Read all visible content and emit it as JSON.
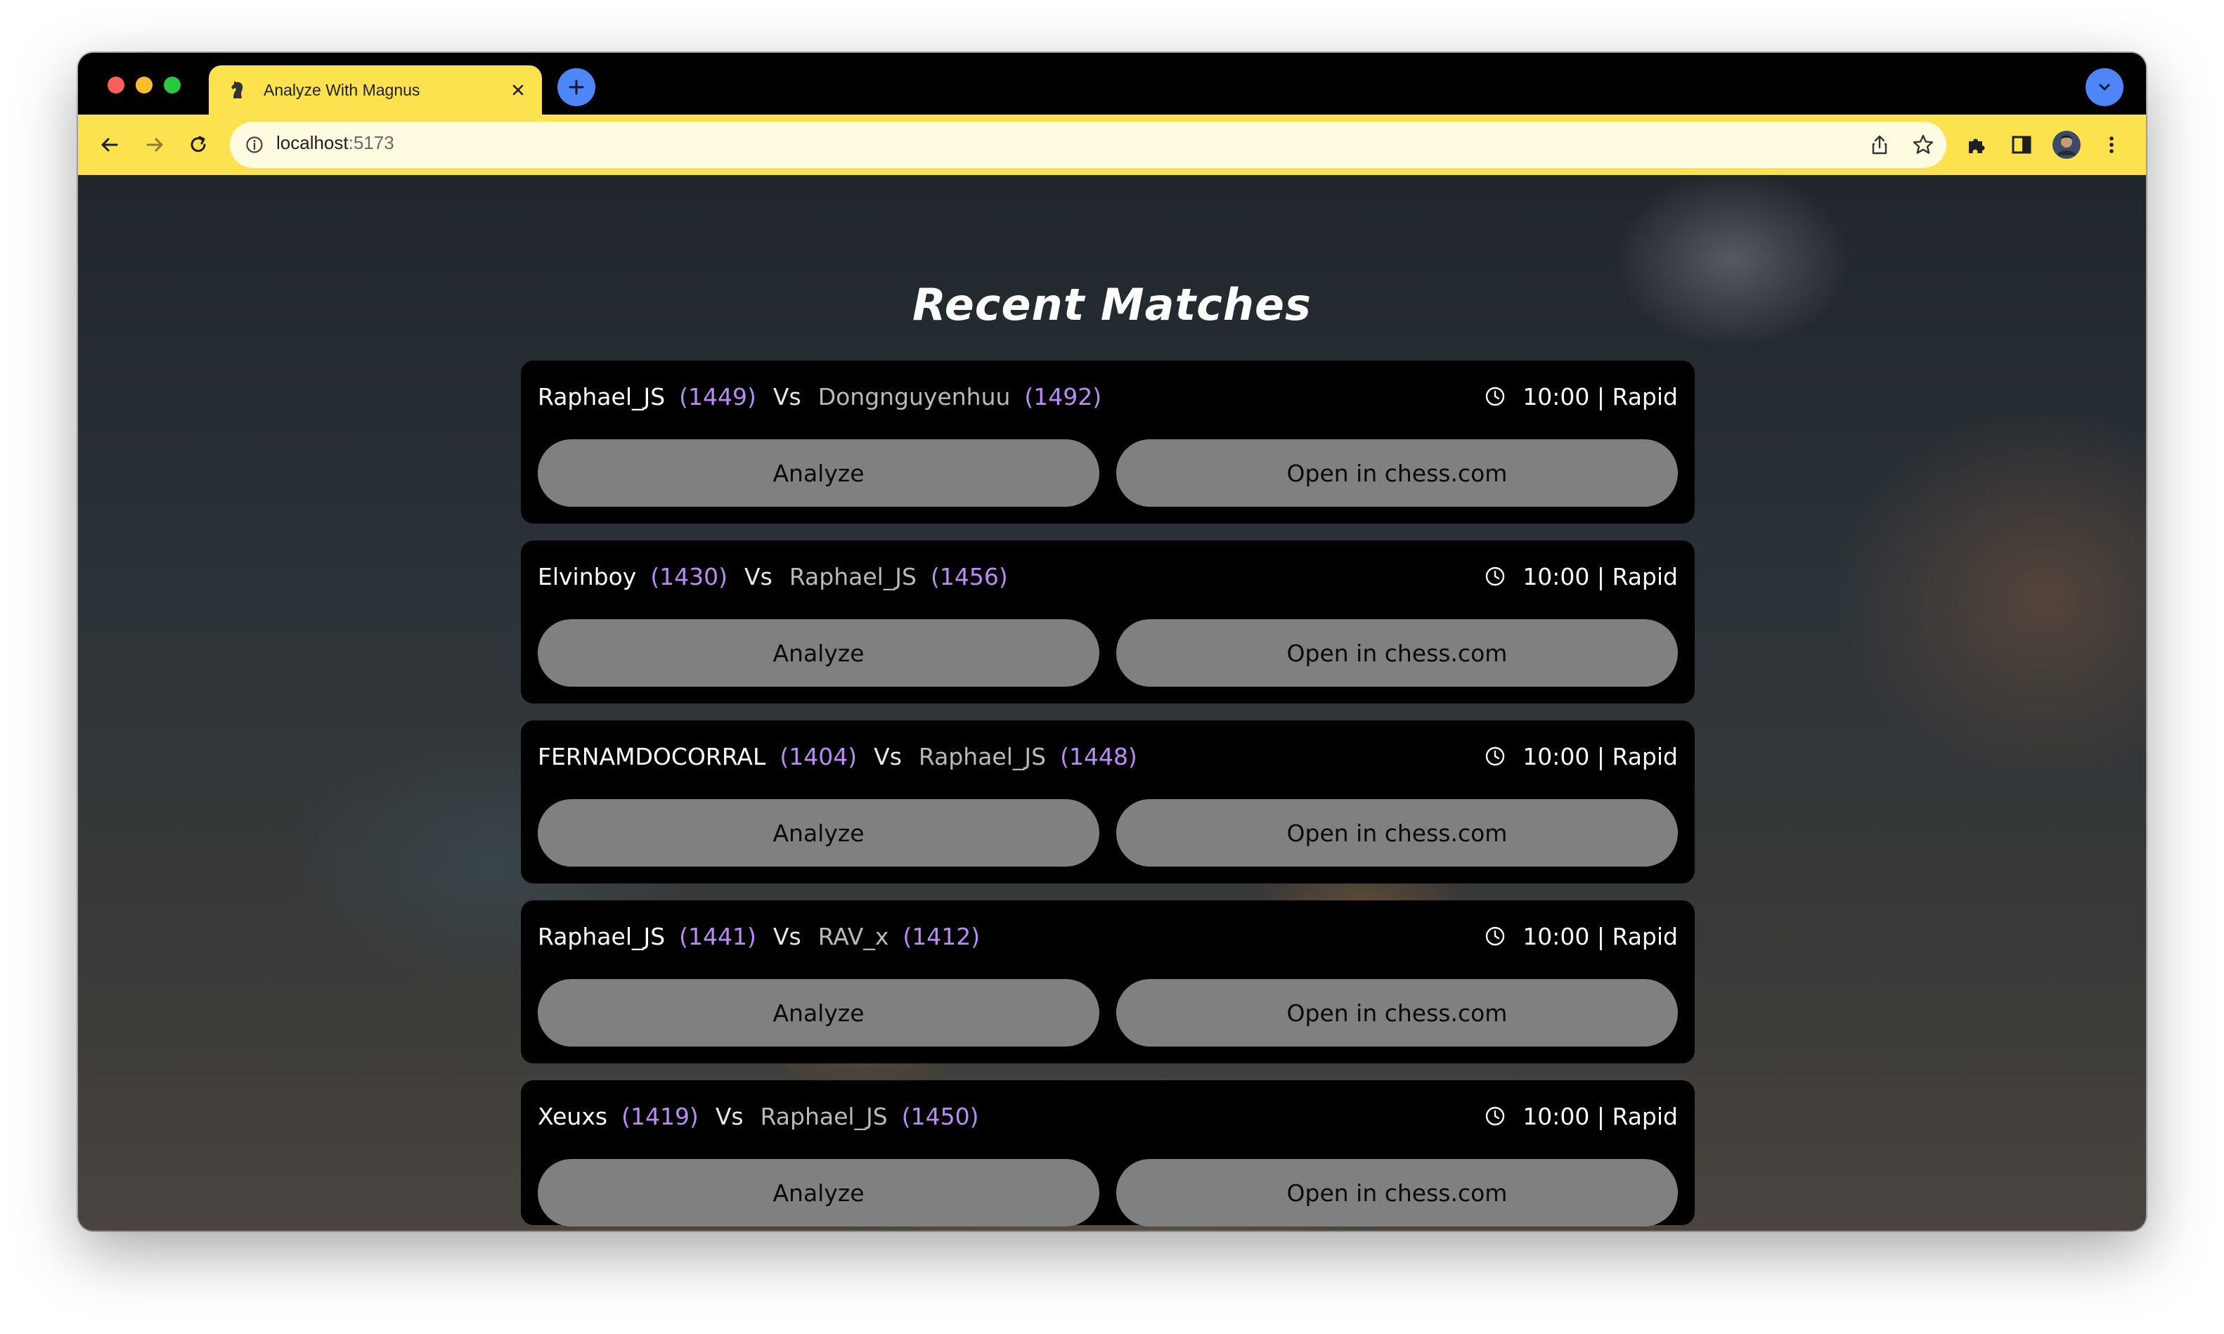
{
  "browser": {
    "tab_title": "Analyze With Magnus",
    "url_host": "localhost",
    "url_port": ":5173",
    "accent_color": "#fce24f"
  },
  "page": {
    "title": "Recent Matches"
  },
  "labels": {
    "vs": "Vs",
    "analyze": "Analyze",
    "open": "Open in chess.com"
  },
  "matches": [
    {
      "white": "Raphael_JS",
      "white_rating": "(1449)",
      "black": "Dongnguyenhuu",
      "black_rating": "(1492)",
      "time": "10:00 | Rapid"
    },
    {
      "white": "Elvinboy",
      "white_rating": "(1430)",
      "black": "Raphael_JS",
      "black_rating": "(1456)",
      "time": "10:00 | Rapid"
    },
    {
      "white": "FERNAMDOCORRAL",
      "white_rating": "(1404)",
      "black": "Raphael_JS",
      "black_rating": "(1448)",
      "time": "10:00 | Rapid"
    },
    {
      "white": "Raphael_JS",
      "white_rating": "(1441)",
      "black": "RAV_x",
      "black_rating": "(1412)",
      "time": "10:00 | Rapid"
    },
    {
      "white": "Xeuxs",
      "white_rating": "(1419)",
      "black": "Raphael_JS",
      "black_rating": "(1450)",
      "time": "10:00 | Rapid"
    }
  ],
  "icons": {
    "favicon": "chess-knight-icon",
    "clock": "clock-icon",
    "extensions": "puzzle-icon",
    "sidepanel": "side-panel-icon",
    "menu": "kebab-menu-icon"
  }
}
